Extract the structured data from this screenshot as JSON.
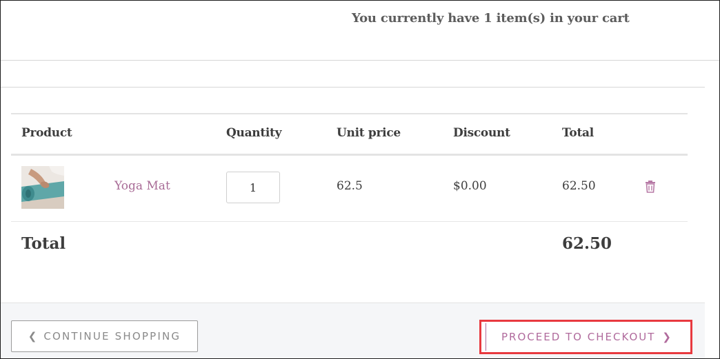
{
  "cart_summary": {
    "message": "You currently have 1 item(s) in your cart"
  },
  "table": {
    "headers": {
      "product": "Product",
      "quantity": "Quantity",
      "unit_price": "Unit price",
      "discount": "Discount",
      "total": "Total"
    },
    "rows": [
      {
        "product_name": "Yoga Mat",
        "quantity": "1",
        "unit_price": "62.5",
        "discount": "$0.00",
        "total": "62.50",
        "thumbnail_icon": "yoga-mat-photo",
        "remove_icon": "trash-icon"
      }
    ]
  },
  "totals": {
    "label": "Total",
    "value": "62.50"
  },
  "footer": {
    "continue_label": "CONTINUE SHOPPING",
    "checkout_label": "PROCEED TO CHECKOUT"
  },
  "colors": {
    "accent": "#a86b96",
    "highlight_border": "#e8393f"
  }
}
